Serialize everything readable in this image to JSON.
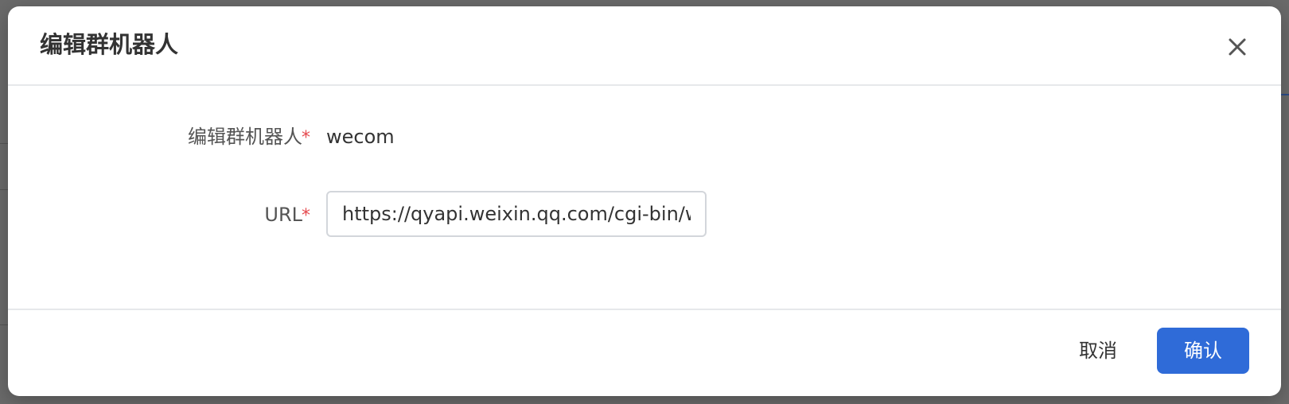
{
  "dialog": {
    "title": "编辑群机器人",
    "close_icon": "close-icon"
  },
  "form": {
    "name": {
      "label": "编辑群机器人",
      "required_mark": "*",
      "value": "wecom"
    },
    "url": {
      "label": "URL",
      "required_mark": "*",
      "value": "https://qyapi.weixin.qq.com/cgi-bin/we"
    }
  },
  "footer": {
    "cancel_label": "取消",
    "confirm_label": "确认"
  },
  "colors": {
    "primary": "#2f6bd8",
    "required": "#e5484d"
  }
}
